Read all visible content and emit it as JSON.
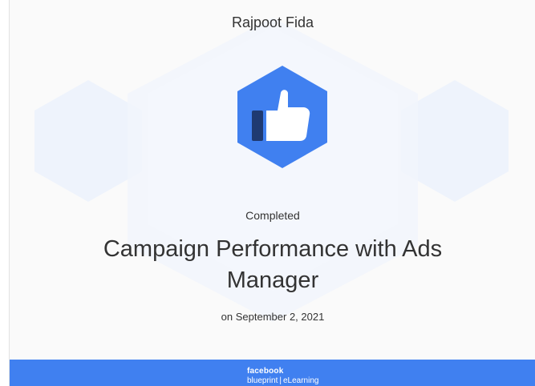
{
  "certificate": {
    "recipient_name": "Rajpoot Fida",
    "status": "Completed",
    "course_title": "Campaign Performance with Ads Manager",
    "completion_date": "on September 2, 2021"
  },
  "footer": {
    "brand_top": "facebook",
    "brand_sub": "blueprint",
    "brand_separator": "|",
    "brand_sub2": "eLearning"
  },
  "colors": {
    "badge_blue": "#4080f0",
    "footer_blue": "#4080f0",
    "text": "#333333",
    "icon_dark": "#1f3a72"
  },
  "icons": {
    "badge": "thumbs-up-icon"
  }
}
